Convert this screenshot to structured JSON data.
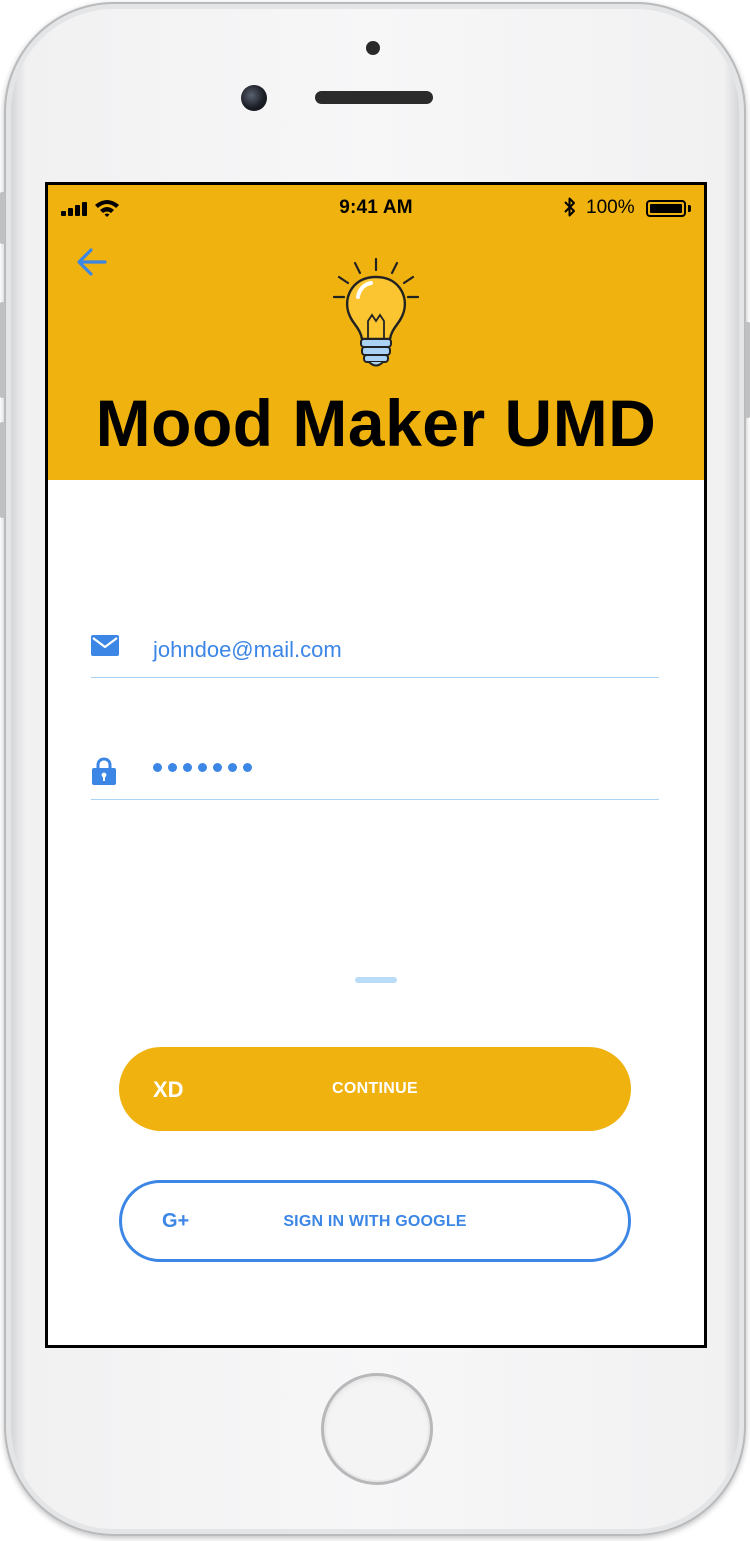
{
  "status_bar": {
    "time": "9:41 AM",
    "battery_percent": "100%",
    "battery_level": 1.0,
    "icons": [
      "signal-icon",
      "wifi-icon",
      "bluetooth-icon",
      "battery-icon"
    ]
  },
  "header": {
    "title": "Mood Maker UMD",
    "background_color": "#f0b20f",
    "back_icon": "arrow-left-icon",
    "logo_icon": "lightbulb-icon"
  },
  "form": {
    "email": {
      "icon": "mail-icon",
      "value": "johndoe@mail.com"
    },
    "password": {
      "icon": "lock-icon",
      "masked_length": 7
    }
  },
  "actions": {
    "continue_prefix": "XD",
    "continue_label": "CONTINUE",
    "google_icon_label": "G+",
    "google_label": "SIGN IN WITH GOOGLE"
  },
  "colors": {
    "accent": "#f0b20f",
    "link_blue": "#3c86e6",
    "divider": "#a9d2f5"
  }
}
